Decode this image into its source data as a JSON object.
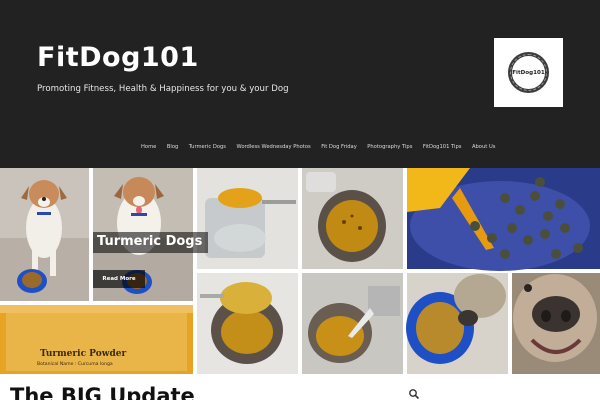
{
  "site": {
    "title": "FitDog101",
    "tagline": "Promoting Fitness, Health & Happiness for you & your Dog",
    "logo_text": "FitDog101"
  },
  "nav": {
    "items": [
      "Home",
      "Blog",
      "Turmeric Dogs",
      "Wordless Wednesday Photos",
      "Fit Dog Friday",
      "Photography Tips",
      "FitDog101 Tips",
      "About Us"
    ]
  },
  "featured": {
    "title": "Turmeric Dogs",
    "read_more": "Read More",
    "package_label": "Turmeric Powder",
    "package_sublabel": "Botanical Name : Curcuma longa"
  },
  "post": {
    "title": "The BIG Update"
  },
  "icons": {
    "search": "search-icon",
    "logo": "logo-badge"
  },
  "colors": {
    "header_bg": "#222222",
    "turmeric": "#e0a020",
    "bowl_blue": "#1f4fc4"
  }
}
